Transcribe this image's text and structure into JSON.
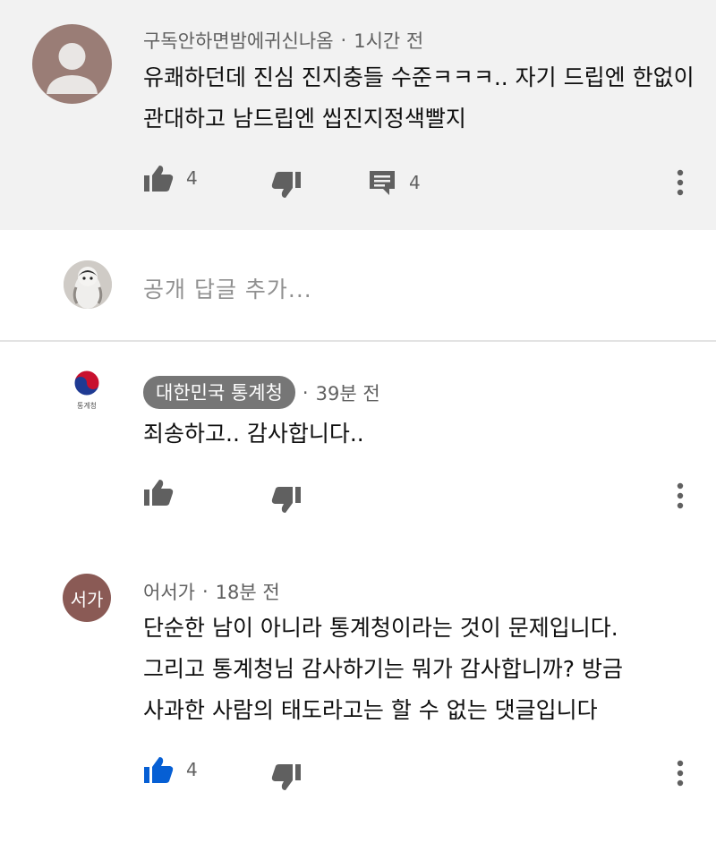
{
  "parent_comment": {
    "author": "구독안하면밤에귀신나옴",
    "time": "1시간 전",
    "lines": [
      "유쾌하던데 진심 진지충들 수준ㅋㅋㅋ.. 자기 드립엔 한없이",
      "관대하고 남드립엔 씹진지정색빨지"
    ],
    "likes": "4",
    "replies": "4"
  },
  "reply_box": {
    "placeholder": "공개 답글 추가..."
  },
  "replies": [
    {
      "author": "대한민국 통계청",
      "avatar_caption": "통계청",
      "time": "39분 전",
      "lines": [
        "죄송하고.. 감사합니다.."
      ]
    },
    {
      "author": "어서가",
      "avatar_text": "서가",
      "time": "18분 전",
      "lines": [
        "단순한 남이 아니라 통계청이라는 것이 문제입니다.",
        "그리고 통계청님 감사하기는 뭐가 감사합니까? 방금",
        "사과한 사람의 태도라고는 할 수 없는 댓글입니다"
      ],
      "likes": "4"
    }
  ],
  "separator": "·",
  "colors": {
    "parent_background": "#f2f2f2",
    "chip_background": "#767676",
    "liked_blue": "#065fd4",
    "icon_gray": "#606060",
    "reply_avatar": "#8a5a55"
  },
  "icons": [
    "thumb-up-icon",
    "thumb-down-icon",
    "comment-icon",
    "more-vertical-icon"
  ]
}
